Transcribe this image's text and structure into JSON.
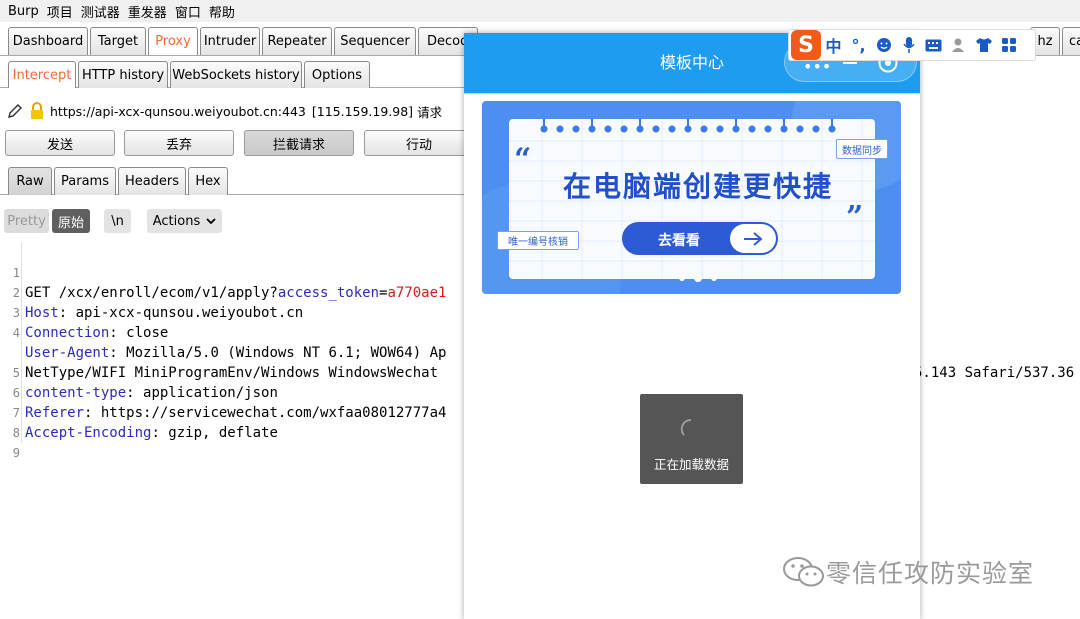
{
  "menu": [
    "Burp",
    "项目",
    "测试器",
    "重发器",
    "窗口",
    "帮助"
  ],
  "main_tabs": [
    "Dashboard",
    "Target",
    "Proxy",
    "Intruder",
    "Repeater",
    "Sequencer",
    "Decoder",
    "hz",
    "ca"
  ],
  "sub_tabs": [
    "Intercept",
    "HTTP history",
    "WebSockets history",
    "Options"
  ],
  "request": {
    "url": "https://api-xcx-qunsou.weiyoubot.cn:443",
    "ip": "[115.159.19.98]",
    "suffix": "请求"
  },
  "actions": {
    "forward": "发送",
    "drop": "丢弃",
    "intercept": "拦截请求",
    "action": "行动"
  },
  "editor_tabs": [
    "Raw",
    "Params",
    "Headers",
    "Hex"
  ],
  "toolbar": {
    "pretty": "Pretty",
    "raw": "原始",
    "newline": "\\n",
    "actions": "Actions"
  },
  "lines": [
    {
      "n": "1",
      "a": "GET /xcx/enroll/ecom/v1/apply?",
      "k": "access_token",
      "b": "=",
      "v": "a770ae1"
    },
    {
      "n": "2",
      "k": "Host",
      "b": ": api-xcx-qunsou.weiyoubot.cn"
    },
    {
      "n": "3",
      "k": "Connection",
      "b": ": close"
    },
    {
      "n": "4",
      "k": "User-Agent",
      "b": ": Mozilla/5.0 (Windows NT 6.1; WOW64) Ap",
      "tail": "5.143 Safari/537.36"
    },
    {
      "n": "",
      "a": "NetType/WIFI MiniProgramEnv/Windows WindowsWechat"
    },
    {
      "n": "5",
      "k": "content-type",
      "b": ": application/json"
    },
    {
      "n": "6",
      "k": "Referer",
      "b": ": https://servicewechat.com/wxfaa08012777a4"
    },
    {
      "n": "7",
      "k": "Accept-Encoding",
      "b": ": gzip, deflate"
    },
    {
      "n": "8"
    },
    {
      "n": "9"
    }
  ],
  "miniprogram": {
    "title": "模板中心",
    "banner_headline": "在电脑端创建更快捷",
    "banner_button": "去看看",
    "tag_sync": "数据同步",
    "tag_verify": "唯一编号核销",
    "loading_text": "正在加载数据"
  },
  "ime": {
    "brand": "S",
    "mode": "中"
  },
  "watermark": "零信任攻防实验室",
  "colors": {
    "proxy_accent": "#ff6633",
    "header_blue": "#1e9df0",
    "banner_blue": "#4d8ef0",
    "button_navy": "#2d5bd6"
  }
}
